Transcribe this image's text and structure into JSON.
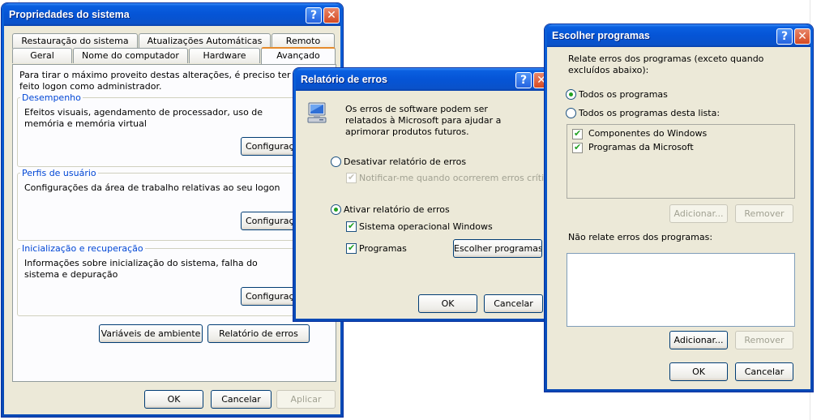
{
  "sysprops": {
    "title": "Propriedades do sistema",
    "tabs_row1": [
      "Restauração do sistema",
      "Atualizações Automáticas",
      "Remoto"
    ],
    "tabs_row2": [
      "Geral",
      "Nome do computador",
      "Hardware",
      "Avançado"
    ],
    "intro": "Para tirar o máximo proveito destas alterações, é preciso ter feito logon como administrador.",
    "perf_label": "Desempenho",
    "perf_text": "Efeitos visuais, agendamento de processador, uso de memória e memória virtual",
    "profiles_label": "Perfis de usuário",
    "profiles_text": "Configurações da área de trabalho relativas ao seu logon",
    "startup_label": "Inicialização e recuperação",
    "startup_text": "Informações sobre inicialização do sistema, falha do sistema e depuração",
    "settings_btn": "Configurações",
    "env_btn": "Variáveis de ambiente",
    "error_btn": "Relatório de erros",
    "ok": "OK",
    "cancel": "Cancelar",
    "apply": "Aplicar"
  },
  "errreport": {
    "title": "Relatório de erros",
    "desc": "Os erros de software podem ser relatados à Microsoft para ajudar a aprimorar produtos futuros.",
    "disable": "Desativar relatório de erros",
    "notify": "Notificar-me quando ocorrerem erros críticos",
    "enable": "Ativar relatório de erros",
    "os": "Sistema operacional Windows",
    "programs": "Programas",
    "choose_btn": "Escolher programas...",
    "ok": "OK",
    "cancel": "Cancelar"
  },
  "choose": {
    "title": "Escolher programas",
    "intro": "Relate erros dos programas (exceto quando excluídos abaixo):",
    "all": "Todos os programas",
    "list_opt": "Todos os programas desta lista:",
    "items": [
      "Componentes do Windows",
      "Programas da Microsoft"
    ],
    "add": "Adicionar...",
    "remove": "Remover",
    "exclude_label": "Não relate erros dos programas:",
    "ok": "OK",
    "cancel": "Cancelar"
  },
  "titlebar_glyphs": {
    "help": "?",
    "close": "✕"
  },
  "colors": {
    "titlebar": "#0554d6",
    "dialog_bg": "#ece9d8",
    "group_label": "#0046d5",
    "check": "#21a121"
  }
}
